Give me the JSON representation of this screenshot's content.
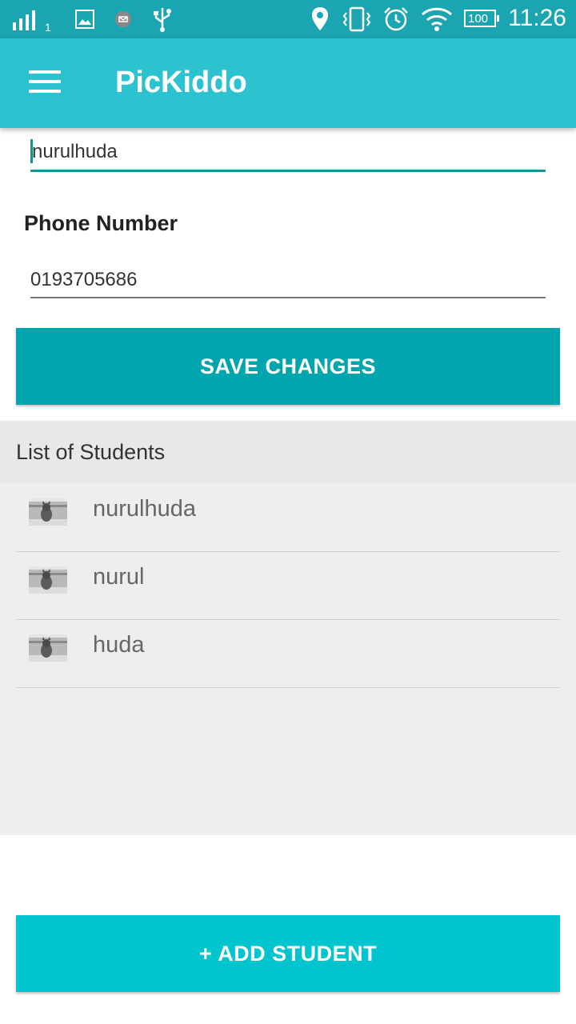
{
  "status_bar": {
    "signal_sub": "1",
    "battery": "100",
    "time": "11:26",
    "icons": [
      "signal-icon",
      "image-icon",
      "message-icon",
      "usb-icon",
      "location-icon",
      "vibrate-icon",
      "alarm-icon",
      "wifi-icon",
      "battery-icon"
    ]
  },
  "app_bar": {
    "title": "PicKiddo",
    "menu_icon": "hamburger-menu-icon"
  },
  "form": {
    "name_value": "nurulhuda",
    "phone_label": "Phone Number",
    "phone_value": "0193705686",
    "save_label": "SAVE CHANGES"
  },
  "students": {
    "header": "List of Students",
    "items": [
      {
        "name": "nurulhuda"
      },
      {
        "name": "nurul"
      },
      {
        "name": "huda"
      }
    ]
  },
  "add_button": {
    "label": "+ ADD STUDENT"
  },
  "colors": {
    "status_bar": "#1aa5b0",
    "app_bar": "#2cc2d0",
    "save_button": "#00a5ae",
    "add_button": "#00c5cf",
    "list_bg": "#eeeeee",
    "focus_underline": "#13968f"
  }
}
